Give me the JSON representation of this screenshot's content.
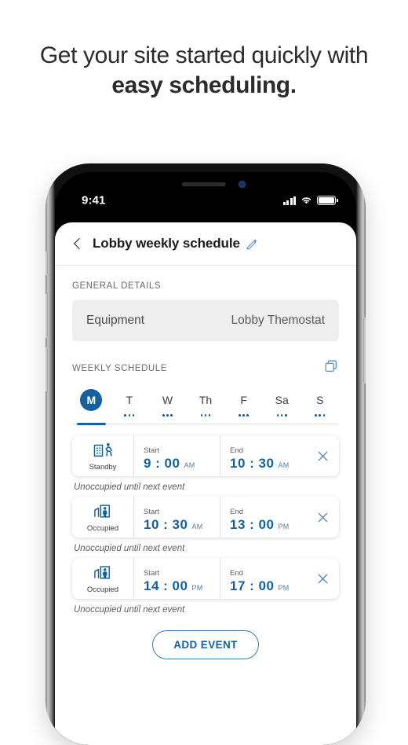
{
  "headline": {
    "line1": "Get your site started quickly with",
    "line2": "easy scheduling."
  },
  "phone": {
    "status_bar": {
      "time": "9:41",
      "signal_icon": "cellular-signal-icon",
      "wifi_icon": "wifi-icon",
      "battery_icon": "battery-full-icon"
    }
  },
  "app": {
    "header": {
      "back_icon": "back-chevron-icon",
      "title": "Lobby weekly schedule",
      "edit_icon": "pencil-edit-icon"
    },
    "general": {
      "section_label": "GENERAL DETAILS",
      "field_label": "Equipment",
      "field_value": "Lobby Themostat"
    },
    "weekly": {
      "section_label": "WEEKLY SCHEDULE",
      "duplicate_icon": "copy-duplicate-icon",
      "days": [
        {
          "label": "M",
          "active": true
        },
        {
          "label": "T",
          "active": false
        },
        {
          "label": "W",
          "active": false
        },
        {
          "label": "Th",
          "active": false
        },
        {
          "label": "F",
          "active": false
        },
        {
          "label": "Sa",
          "active": false
        },
        {
          "label": "S",
          "active": false
        }
      ]
    },
    "events": [
      {
        "mode": "Standby",
        "mode_icon": "building-person-leaving-icon",
        "start_label": "Start",
        "start_time": "9 : 00",
        "start_meridiem": "AM",
        "end_label": "End",
        "end_time": "10 : 30",
        "end_meridiem": "AM",
        "close_icon": "close-x-icon",
        "note": "Unoccupied until next event"
      },
      {
        "mode": "Occupied",
        "mode_icon": "building-person-inside-icon",
        "start_label": "Start",
        "start_time": "10 : 30",
        "start_meridiem": "AM",
        "end_label": "End",
        "end_time": "13 : 00",
        "end_meridiem": "PM",
        "close_icon": "close-x-icon",
        "note": "Unoccupied until next event"
      },
      {
        "mode": "Occupied",
        "mode_icon": "building-person-inside-icon",
        "start_label": "Start",
        "start_time": "14 : 00",
        "start_meridiem": "PM",
        "end_label": "End",
        "end_time": "17 : 00",
        "end_meridiem": "PM",
        "close_icon": "close-x-icon",
        "note": "Unoccupied until next event"
      }
    ],
    "add_event_button": "ADD EVENT"
  },
  "colors": {
    "accent_blue": "#15619e",
    "accent_blue_light": "#4a7fae",
    "field_gray": "#eeeeee",
    "text_dark": "#1a1a1a"
  }
}
